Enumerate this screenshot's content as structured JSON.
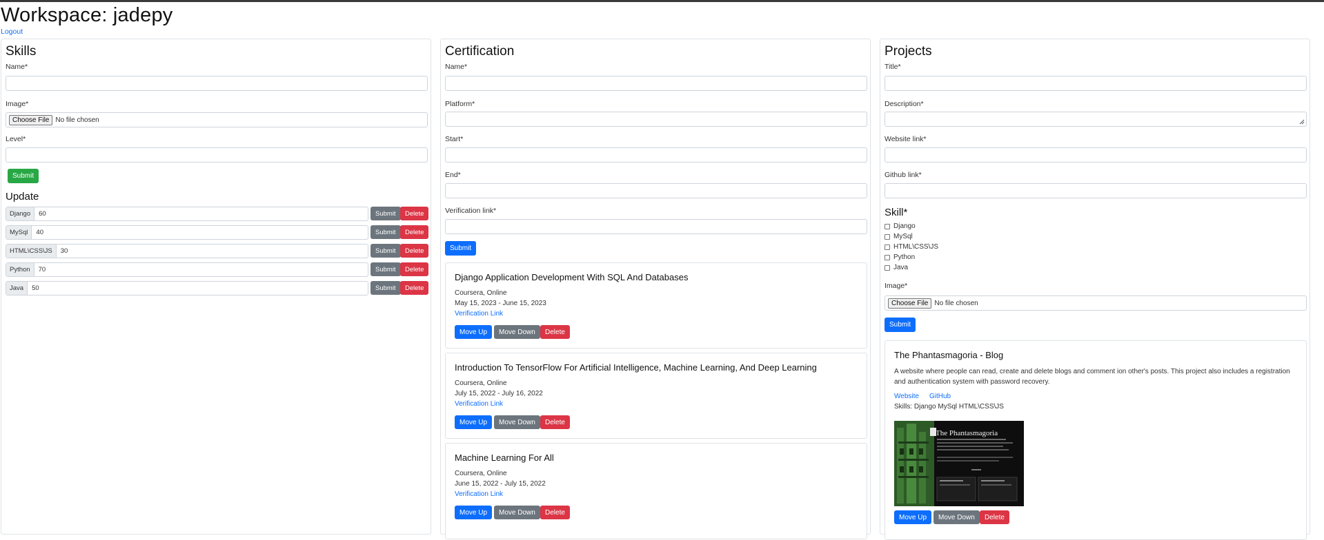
{
  "header": {
    "title": "Workspace: jadepy",
    "logout": "Logout"
  },
  "skills": {
    "title": "Skills",
    "name_label": "Name*",
    "image_label": "Image*",
    "choose_file": "Choose File",
    "no_file": "No file chosen",
    "level_label": "Level*",
    "submit": "Submit",
    "update_title": "Update",
    "rows": [
      {
        "name": "Django",
        "level": "60"
      },
      {
        "name": "MySql",
        "level": "40"
      },
      {
        "name": "HTML\\CSS\\JS",
        "level": "30"
      },
      {
        "name": "Python",
        "level": "70"
      },
      {
        "name": "Java",
        "level": "50"
      }
    ],
    "row_submit": "Submit",
    "row_delete": "Delete"
  },
  "certification": {
    "title": "Certification",
    "name_label": "Name*",
    "platform_label": "Platform*",
    "start_label": "Start*",
    "end_label": "End*",
    "verification_label": "Verification link*",
    "submit": "Submit",
    "move_up": "Move Up",
    "move_down": "Move Down",
    "delete": "Delete",
    "items": [
      {
        "title": "Django Application Development With SQL And Databases",
        "platform": "Coursera, Online",
        "dates": "May 15, 2023 - June 15, 2023",
        "link": "Verification Link"
      },
      {
        "title": "Introduction To TensorFlow For Artificial Intelligence, Machine Learning, And Deep Learning",
        "platform": "Coursera, Online",
        "dates": "July 15, 2022 - July 16, 2022",
        "link": "Verification Link"
      },
      {
        "title": "Machine Learning For All",
        "platform": "Coursera, Online",
        "dates": "June 15, 2022 - July 15, 2022",
        "link": "Verification Link"
      }
    ]
  },
  "projects": {
    "title": "Projects",
    "title_label": "Title*",
    "description_label": "Description*",
    "website_label": "Website link*",
    "github_label": "Github link*",
    "skill_title": "Skill*",
    "skill_options": [
      "Django",
      "MySql",
      "HTML\\CSS\\JS",
      "Python",
      "Java"
    ],
    "image_label": "Image*",
    "choose_file": "Choose File",
    "no_file": "No file chosen",
    "submit": "Submit",
    "card": {
      "title": "The Phantasmagoria - Blog",
      "description": "A website where people can read, create and delete blogs and comment ion other's posts. This project also includes a registration and authentication system with password recovery.",
      "website": "Website",
      "github": "GitHub",
      "skills": "Skills: Django MySql HTML\\CSS\\JS",
      "thumb_heading": "The Phantasmagoria",
      "move_up": "Move Up",
      "move_down": "Move Down",
      "delete": "Delete"
    }
  },
  "colors": {
    "primary": "#0d6efd",
    "success": "#28a745",
    "secondary": "#6c757d",
    "danger": "#dc3545"
  }
}
